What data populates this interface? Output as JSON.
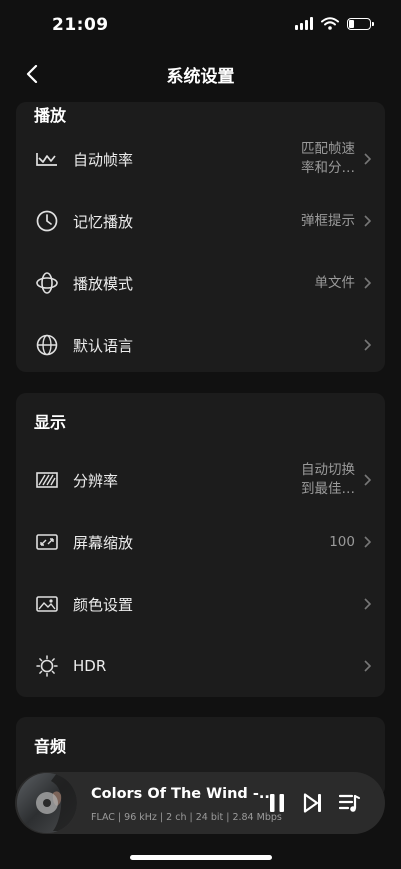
{
  "status_bar": {
    "time": "21:09"
  },
  "header": {
    "title": "系统设置"
  },
  "sections": {
    "playback": {
      "title": "播放",
      "items": [
        {
          "label": "自动帧率",
          "value": "匹配帧速率和分…",
          "icon": "waveform-icon"
        },
        {
          "label": "记忆播放",
          "value": "弹框提示",
          "icon": "clock-icon"
        },
        {
          "label": "播放模式",
          "value": "单文件",
          "icon": "orbit-icon"
        },
        {
          "label": "默认语言",
          "value": "",
          "icon": "globe-icon"
        }
      ]
    },
    "display": {
      "title": "显示",
      "items": [
        {
          "label": "分辨率",
          "value": "自动切换到最佳…",
          "icon": "resolution-icon"
        },
        {
          "label": "屏幕缩放",
          "value": "100",
          "icon": "screen-scale-icon"
        },
        {
          "label": "颜色设置",
          "value": "",
          "icon": "image-icon"
        },
        {
          "label": "HDR",
          "value": "",
          "icon": "sun-icon"
        }
      ]
    },
    "audio": {
      "title": "音频"
    }
  },
  "player": {
    "song_title": "Colors Of The Wind -...",
    "meta": "FLAC | 96 kHz | 2 ch | 24 bit | 2.84 Mbps"
  }
}
